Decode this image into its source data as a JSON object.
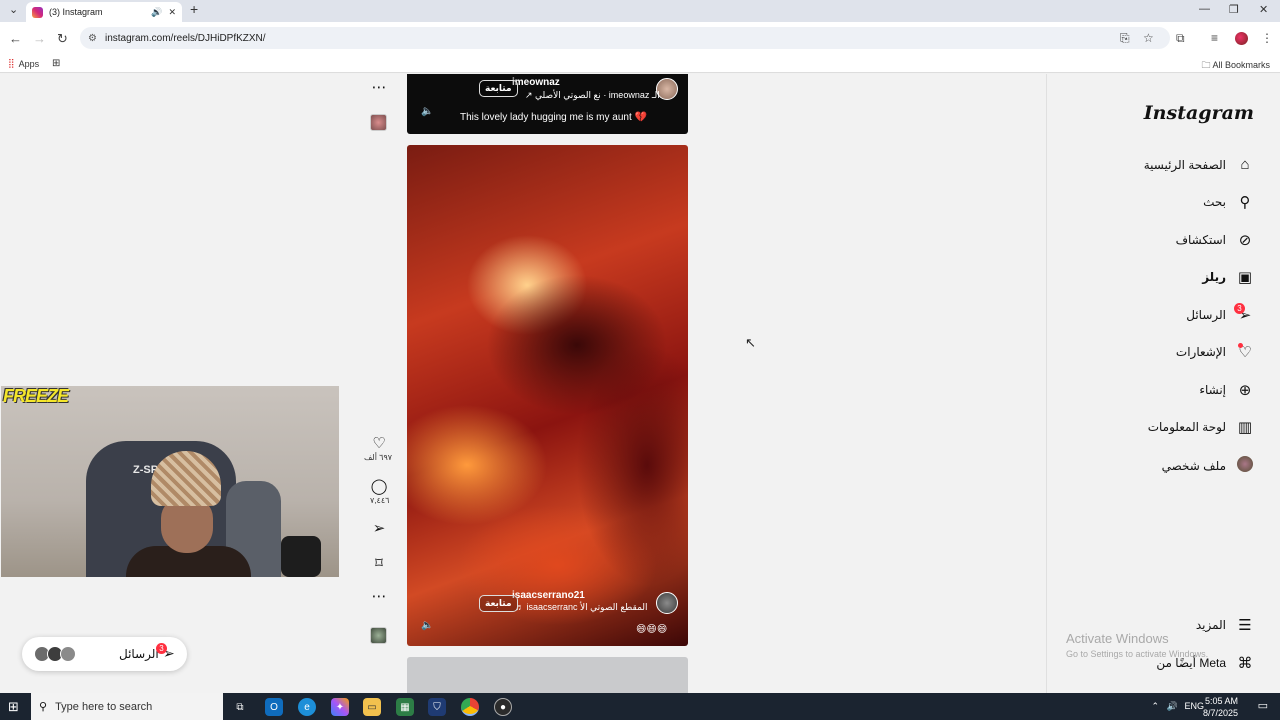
{
  "browser": {
    "tab_title": "(3) Instagram",
    "url": "instagram.com/reels/DJHiDPfKZXN/",
    "bookmarks": {
      "apps_label": "Apps",
      "all_bookmarks_label": "All Bookmarks"
    }
  },
  "sidebar": {
    "logo": "Instagram",
    "items": [
      {
        "label": "الصفحة الرئيسية",
        "icon": "home-icon"
      },
      {
        "label": "بحث",
        "icon": "search-icon"
      },
      {
        "label": "استكشاف",
        "icon": "compass-icon"
      },
      {
        "label": "ريلز",
        "icon": "reels-icon",
        "active": true
      },
      {
        "label": "الرسائل",
        "icon": "messenger-icon",
        "badge": "3"
      },
      {
        "label": "الإشعارات",
        "icon": "heart-icon"
      },
      {
        "label": "إنشاء",
        "icon": "plus-square-icon"
      },
      {
        "label": "لوحة المعلومات",
        "icon": "dashboard-icon"
      },
      {
        "label": "ملف شخصي",
        "icon": "avatar"
      }
    ],
    "more_label": "المزيد",
    "meta_label": "أيضًا من Meta"
  },
  "reels": [
    {
      "username": "imeownaz",
      "audio": "↗ نع الصوتي الأصلي · imeownaz  الـ",
      "follow_label": "متابعة",
      "caption": "This lovely lady hugging me is my aunt 💔"
    },
    {
      "username": "isaacserrano21",
      "audio": "♬ isaacserranc المقطع الصوتي الأ",
      "follow_label": "متابعة",
      "caption": "😄😄😄",
      "likes": "٦٩٧ ألف",
      "comments": "٧,٤٤٦"
    }
  ],
  "webcam": {
    "overlay_text": "FREEZE",
    "chair_brand": "Z-SP"
  },
  "messages_pill": {
    "label": "الرسائل",
    "badge": "3"
  },
  "watermark": {
    "title": "Activate Windows",
    "subtitle": "Go to Settings to activate Windows."
  },
  "taskbar": {
    "search_placeholder": "Type here to search",
    "language": "ENG",
    "time": "5:05 AM",
    "date": "8/7/2025"
  }
}
